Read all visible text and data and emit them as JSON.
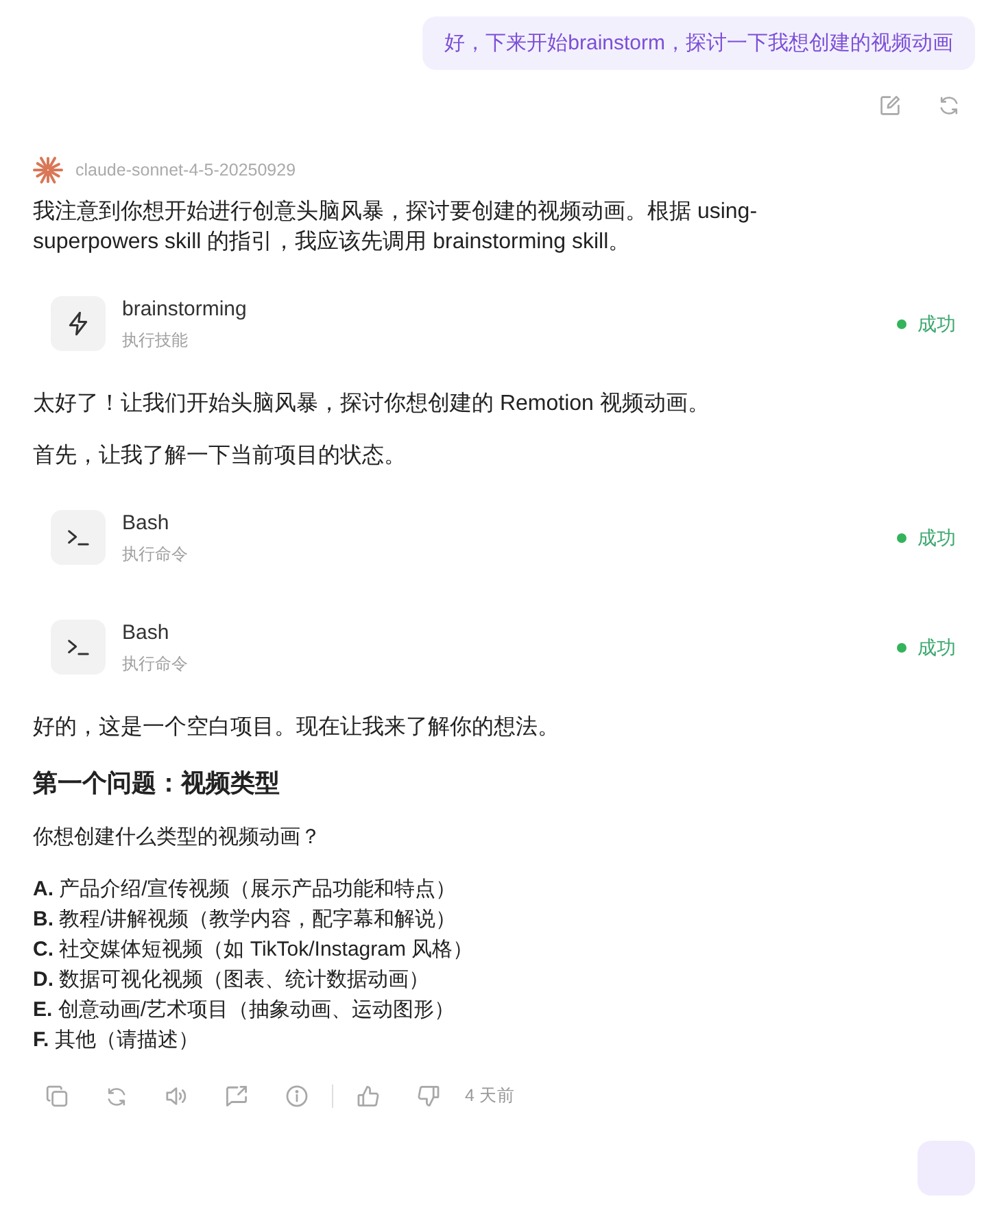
{
  "user_message": {
    "text": "好，下来开始brainstorm，探讨一下我想创建的视频动画"
  },
  "assistant_message": {
    "model": "claude-sonnet-4-5-20250929",
    "blocks": [
      {
        "kind": "paragraph",
        "text": "我注意到你想开始进行创意头脑风暴，探讨要创建的视频动画。根据 using-superpowers skill 的指引，我应该先调用 brainstorming skill。"
      },
      {
        "kind": "skill_call",
        "name": "brainstorming",
        "subtitle": "执行技能",
        "status": "成功",
        "success": true
      },
      {
        "kind": "paragraph",
        "text": "太好了！让我们开始头脑风暴，探讨你想创建的 Remotion 视频动画。"
      },
      {
        "kind": "paragraph",
        "text": "首先，让我了解一下当前项目的状态。"
      },
      {
        "kind": "command_call",
        "name": "Bash",
        "subtitle": "执行命令",
        "status": "成功",
        "success": true
      },
      {
        "kind": "command_call",
        "name": "Bash",
        "subtitle": "执行命令",
        "status": "成功",
        "success": true
      },
      {
        "kind": "paragraph",
        "text": "好的，这是一个空白项目。现在让我来了解你的想法。"
      },
      {
        "kind": "heading",
        "text": "第一个问题：视频类型"
      },
      {
        "kind": "question",
        "text": "你想创建什么类型的视频动画？"
      },
      {
        "kind": "options",
        "items": [
          {
            "label": "A.",
            "text": "产品介绍/宣传视频（展示产品功能和特点）"
          },
          {
            "label": "B.",
            "text": "教程/讲解视频（教学内容，配字幕和解说）"
          },
          {
            "label": "C.",
            "text": "社交媒体短视频（如 TikTok/Instagram 风格）"
          },
          {
            "label": "D.",
            "text": "数据可视化视频（图表、统计数据动画）"
          },
          {
            "label": "E.",
            "text": "创意动画/艺术项目（抽象动画、运动图形）"
          },
          {
            "label": "F.",
            "text": "其他（请描述）"
          }
        ]
      }
    ],
    "timestamp": "4 天前"
  }
}
